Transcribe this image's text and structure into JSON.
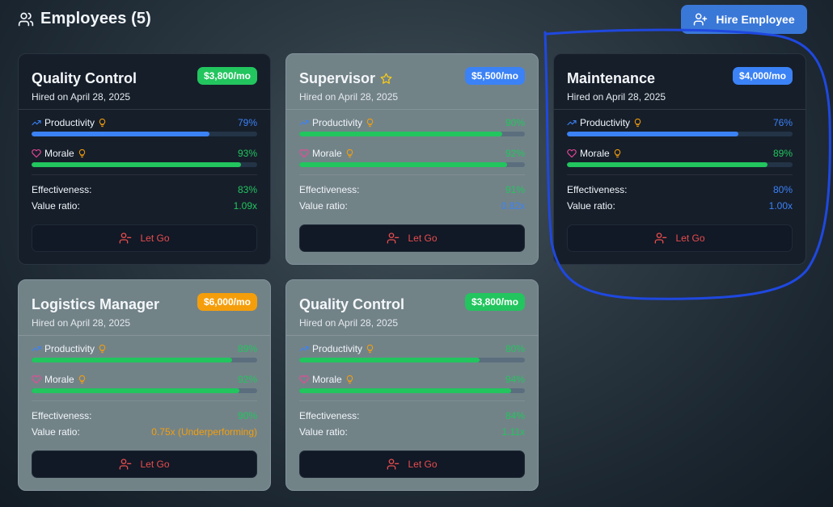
{
  "header": {
    "title": "Employees (5)",
    "icon": "users-icon"
  },
  "hire_button": {
    "label": "Hire Employee",
    "icon": "user-plus-icon"
  },
  "labels": {
    "productivity": "Productivity",
    "morale": "Morale",
    "effectiveness": "Effectiveness:",
    "value_ratio": "Value ratio:",
    "let_go": "Let Go"
  },
  "colors": {
    "green": "#22c55e",
    "blue": "#3b82f6",
    "orange": "#f59e0b",
    "red": "#e84d4d",
    "pink": "#ec4899"
  },
  "employees": [
    {
      "title": "Quality Control",
      "hired": "Hired on April 28, 2025",
      "salary": "$3,800/mo",
      "salary_color": "green",
      "star": false,
      "style": "dark",
      "productivity": {
        "text": "79%",
        "value": 79,
        "color": "blue"
      },
      "morale": {
        "text": "93%",
        "value": 93,
        "color": "green"
      },
      "effectiveness": {
        "text": "83%",
        "color": "green"
      },
      "value_ratio": {
        "text": "1.09x",
        "color": "green"
      }
    },
    {
      "title": "Supervisor",
      "hired": "Hired on April 28, 2025",
      "salary": "$5,500/mo",
      "salary_color": "blue",
      "star": true,
      "style": "light",
      "productivity": {
        "text": "90%",
        "value": 90,
        "color": "green"
      },
      "morale": {
        "text": "92%",
        "value": 92,
        "color": "green"
      },
      "effectiveness": {
        "text": "91%",
        "color": "green"
      },
      "value_ratio": {
        "text": "0.82x",
        "color": "blue"
      }
    },
    {
      "title": "Maintenance",
      "hired": "Hired on April 28, 2025",
      "salary": "$4,000/mo",
      "salary_color": "blue",
      "star": false,
      "style": "dark",
      "productivity": {
        "text": "76%",
        "value": 76,
        "color": "blue"
      },
      "morale": {
        "text": "89%",
        "value": 89,
        "color": "green"
      },
      "effectiveness": {
        "text": "80%",
        "color": "blue"
      },
      "value_ratio": {
        "text": "1.00x",
        "color": "blue"
      }
    },
    {
      "title": "Logistics Manager",
      "hired": "Hired on April 28, 2025",
      "salary": "$6,000/mo",
      "salary_color": "orange",
      "star": false,
      "style": "light",
      "productivity": {
        "text": "89%",
        "value": 89,
        "color": "green"
      },
      "morale": {
        "text": "92%",
        "value": 92,
        "color": "green"
      },
      "effectiveness": {
        "text": "90%",
        "color": "green"
      },
      "value_ratio": {
        "text": "0.75x (Underperforming)",
        "color": "orange"
      }
    },
    {
      "title": "Quality Control",
      "hired": "Hired on April 28, 2025",
      "salary": "$3,800/mo",
      "salary_color": "green",
      "star": false,
      "style": "light",
      "productivity": {
        "text": "80%",
        "value": 80,
        "color": "green"
      },
      "morale": {
        "text": "94%",
        "value": 94,
        "color": "green"
      },
      "effectiveness": {
        "text": "84%",
        "color": "green"
      },
      "value_ratio": {
        "text": "1.11x",
        "color": "green"
      }
    }
  ]
}
